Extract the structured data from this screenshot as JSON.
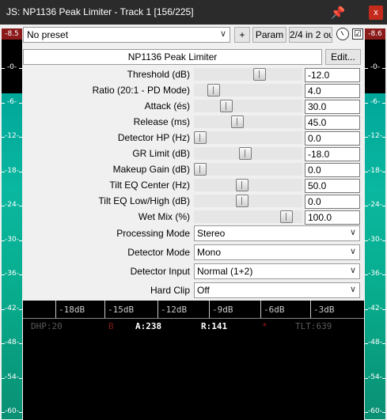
{
  "window": {
    "title": "JS: NP1136 Peak Limiter - Track 1 [156/225]",
    "pin_icon": "pin-icon",
    "close_label": "x"
  },
  "toolbar": {
    "preset_value": "No preset",
    "plus_label": "+",
    "param_label": "Param",
    "io_label": "2/4 in 2 ou",
    "enable_checked": "☑"
  },
  "plugin": {
    "name": "NP1136 Peak Limiter",
    "edit_label": "Edit..."
  },
  "meters": {
    "left_peak": "-8.5",
    "right_peak": "-8.6",
    "ticks": [
      "-0-",
      "-6-",
      "-12-",
      "-18-",
      "-24-",
      "-30-",
      "-36-",
      "-42-",
      "-48-",
      "-54-",
      "-60-"
    ]
  },
  "params": [
    {
      "label": "Threshold (dB)",
      "value": "-12.0",
      "pos": 0.62
    },
    {
      "label": "Ratio (20:1 - PD Mode)",
      "value": "4.0",
      "pos": 0.14
    },
    {
      "label": "Attack (és)",
      "value": "30.0",
      "pos": 0.27
    },
    {
      "label": "Release (ms)",
      "value": "45.0",
      "pos": 0.39
    },
    {
      "label": "Detector HP (Hz)",
      "value": "0.0",
      "pos": 0.0
    },
    {
      "label": "GR Limit (dB)",
      "value": "-18.0",
      "pos": 0.47
    },
    {
      "label": "Makeup Gain (dB)",
      "value": "0.0",
      "pos": 0.0
    },
    {
      "label": "Tilt EQ Center (Hz)",
      "value": "50.0",
      "pos": 0.44
    },
    {
      "label": "Tilt EQ Low/High (dB)",
      "value": "0.0",
      "pos": 0.44
    },
    {
      "label": "Wet Mix (%)",
      "value": "100.0",
      "pos": 0.9
    }
  ],
  "selects": [
    {
      "label": "Processing Mode",
      "value": "Stereo"
    },
    {
      "label": "Detector Mode",
      "value": "Mono"
    },
    {
      "label": "Detector Input",
      "value": "Normal (1+2)"
    },
    {
      "label": "Hard Clip",
      "value": "Off"
    }
  ],
  "scope": {
    "scale": [
      "-18dB",
      "-15dB",
      "-12dB",
      "-9dB",
      "-6dB",
      "-3dB"
    ],
    "readouts": {
      "dhp": "DHP:20",
      "b": "B",
      "a": "A:238",
      "r": "R:141",
      "star": "*",
      "tlt": "TLT:639"
    },
    "colors": {
      "dim": "#5a5a5a",
      "bright": "#ffffff",
      "b": "#7a1a1a",
      "star": "#a01818"
    }
  }
}
